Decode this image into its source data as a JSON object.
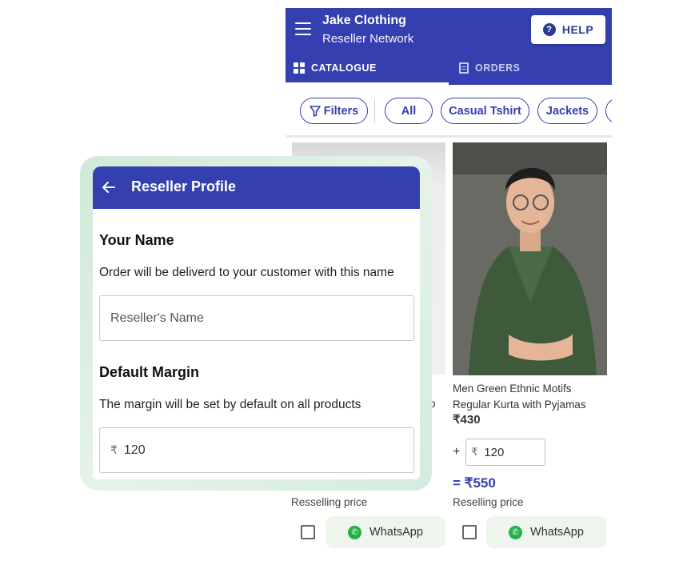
{
  "app": {
    "title": "Jake Clothing",
    "subtitle": "Reseller Network",
    "help_label": "HELP",
    "help_icon": "?",
    "tabs": [
      {
        "label": "CATALOGUE",
        "icon": "grid-icon",
        "active": true
      },
      {
        "label": "ORDERS",
        "icon": "receipt-icon",
        "active": false
      }
    ],
    "filters_label": "Filters",
    "chips": [
      "All",
      "Casual Tshirt",
      "Jackets"
    ]
  },
  "products": {
    "left": {
      "resell_label": "Resselling price",
      "whatsapp_label": "WhatsApp"
    },
    "right": {
      "name": "Men Green Ethnic Motifs Regular Kurta with Pyjamas",
      "price": "₹430",
      "plus": "+",
      "currency": "₹",
      "margin": "120",
      "reselling_price": "= ₹550",
      "resell_label": "Reselling price",
      "whatsapp_label": "WhatsApp"
    }
  },
  "profile": {
    "title": "Reseller Profile",
    "name_title": "Your Name",
    "name_desc": "Order will be deliverd to your customer with this name",
    "name_placeholder": "Reseller's Name",
    "margin_title": "Default Margin",
    "margin_desc": "The margin will be set by default on all products",
    "currency": "₹",
    "margin_value": "120"
  },
  "colors": {
    "primary": "#3440b0",
    "whatsapp": "#25b14a",
    "card_glow": "#d4ebe0"
  }
}
